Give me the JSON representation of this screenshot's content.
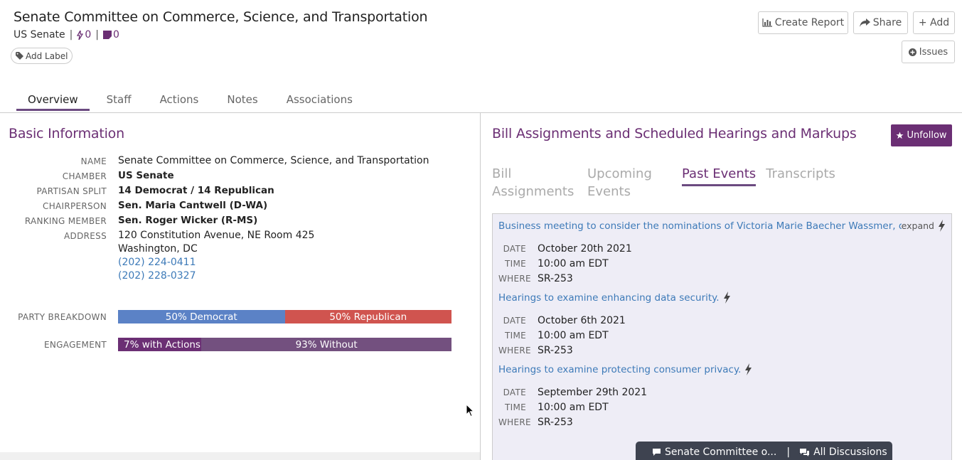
{
  "header": {
    "title": "Senate Committee on Commerce, Science, and Transportation",
    "chamber": "US Senate",
    "actions_count": "0",
    "notes_count": "0",
    "add_label": "Add Label"
  },
  "toolbar": {
    "create_report": "Create Report",
    "share": "Share",
    "add": "+ Add",
    "issues": "Issues"
  },
  "tabs": [
    {
      "label": "Overview",
      "active": true
    },
    {
      "label": "Staff"
    },
    {
      "label": "Actions"
    },
    {
      "label": "Notes"
    },
    {
      "label": "Associations"
    }
  ],
  "basic_info": {
    "title": "Basic Information",
    "fields": {
      "name_label": "NAME",
      "name": "Senate Committee on Commerce, Science, and Transportation",
      "chamber_label": "CHAMBER",
      "chamber": "US Senate",
      "partisan_label": "PARTISAN SPLIT",
      "partisan": "14 Democrat / 14 Republican",
      "chair_label": "CHAIRPERSON",
      "chair": "Sen. Maria Cantwell (D-WA)",
      "ranking_label": "RANKING MEMBER",
      "ranking": "Sen. Roger Wicker (R-MS)",
      "address_label": "ADDRESS",
      "address_line1": "120 Constitution Avenue, NE Room 425",
      "address_line2": "Washington, DC",
      "phone1": "(202) 224-0411",
      "phone2": "(202) 228-0327"
    },
    "party_breakdown": {
      "label": "PARTY BREAKDOWN",
      "democrat_text": "50% Democrat",
      "republican_text": "50% Republican",
      "democrat_fraction": 0.5,
      "democrat_color": "#5b82c6",
      "republican_color": "#d0544f"
    },
    "engagement": {
      "label": "ENGAGEMENT",
      "with_text": "7% with Actions",
      "without_text": "93% Without",
      "with_fraction": 0.25,
      "with_color": "#6b2f74",
      "without_color": "#73507f"
    }
  },
  "bills": {
    "title": "Bill Assignments and Scheduled Hearings and Markups",
    "unfollow": "Unfollow",
    "subtabs": [
      {
        "line1": "Bill",
        "line2": "Assignments"
      },
      {
        "line1": "Upcoming",
        "line2": "Events"
      },
      {
        "line1": "Past Events",
        "line2": "",
        "active": true
      },
      {
        "line1": "Transcripts",
        "line2": ""
      }
    ],
    "labels": {
      "date": "DATE",
      "time": "TIME",
      "where": "WHERE"
    },
    "events": [
      {
        "title": "Business meeting to consider the nominations of Victoria Marie Baecher Wassmer, of...",
        "expand": "expand",
        "date": "October 20th 2021",
        "time": "10:00 am EDT",
        "where": "SR-253"
      },
      {
        "title": "Hearings to examine enhancing data security.",
        "expand": "",
        "date": "October 6th 2021",
        "time": "10:00 am EDT",
        "where": "SR-253"
      },
      {
        "title": "Hearings to examine protecting consumer privacy.",
        "expand": "",
        "date": "September 29th 2021",
        "time": "10:00 am EDT",
        "where": "SR-253"
      }
    ]
  },
  "chatbar": {
    "committee": "Senate Committee o...",
    "all": "All Discussions"
  },
  "colors": {
    "accent": "#6b2f74",
    "link": "#3d7ab8"
  }
}
